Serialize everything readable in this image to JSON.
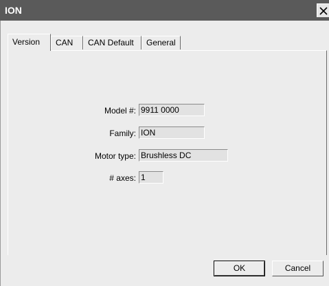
{
  "window": {
    "title": "ION",
    "close_label": "Close"
  },
  "tabs": [
    {
      "label": "Version"
    },
    {
      "label": "CAN"
    },
    {
      "label": "CAN Default"
    },
    {
      "label": "General"
    }
  ],
  "version_panel": {
    "model": {
      "label": "Model #:",
      "value": "9911 0000"
    },
    "family": {
      "label": "Family:",
      "value": "ION"
    },
    "motor_type": {
      "label": "Motor type:",
      "value": "Brushless DC"
    },
    "axes": {
      "label": "# axes:",
      "value": "1"
    }
  },
  "buttons": {
    "ok": "OK",
    "cancel": "Cancel"
  }
}
